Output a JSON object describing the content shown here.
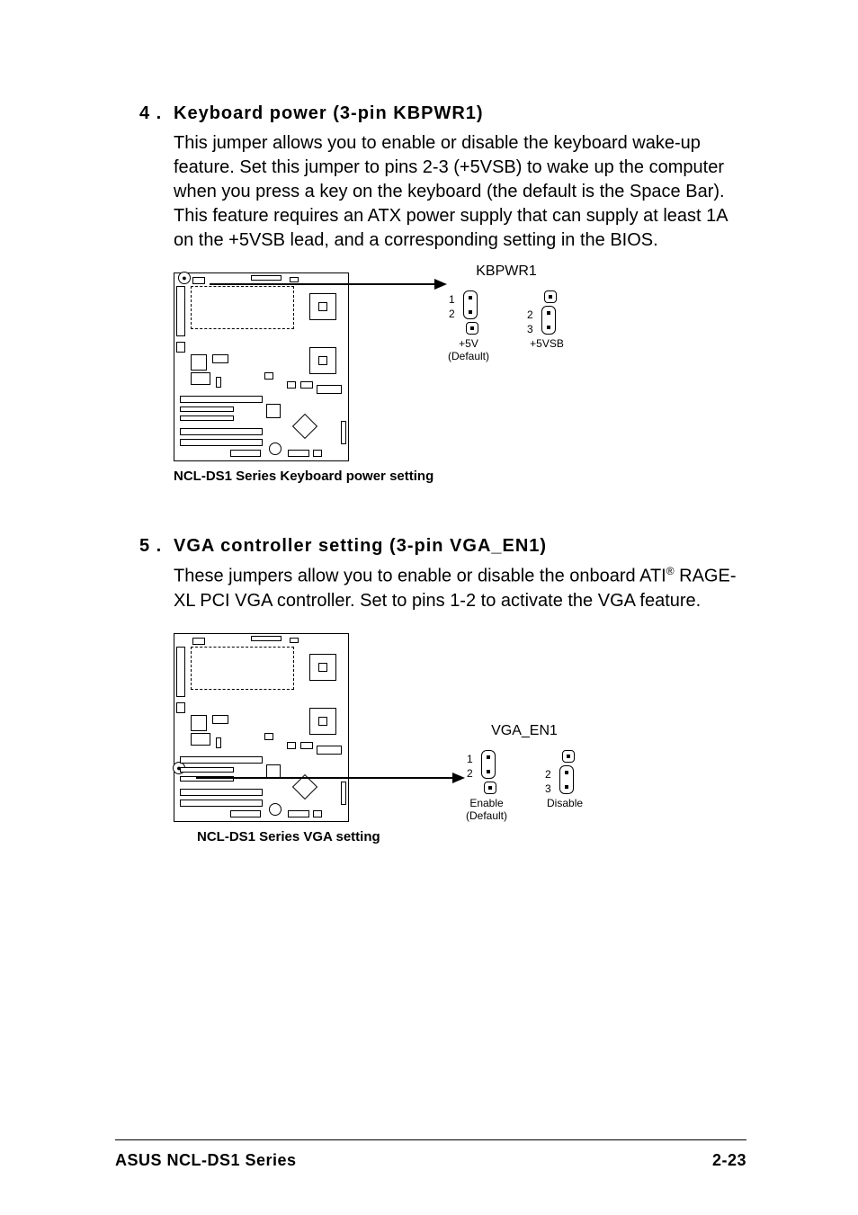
{
  "section4": {
    "num": "4 .",
    "title": "Keyboard power (3-pin KBPWR1)",
    "body": "This jumper allows you to enable or disable the keyboard wake-up feature. Set this jumper to pins 2-3 (+5VSB) to wake up the computer when you press a key on the keyboard (the default is the Space Bar). This feature requires an ATX power supply that can supply at least 1A on the +5VSB lead, and a corresponding setting in the BIOS.",
    "caption": "NCL-DS1 Series Keyboard power setting",
    "jumper_title": "KBPWR1",
    "opt1_pins": [
      "1",
      "2"
    ],
    "opt1_label_a": "+5V",
    "opt1_label_b": "(Default)",
    "opt2_pins": [
      "2",
      "3"
    ],
    "opt2_label_a": "+5VSB",
    "opt2_label_b": ""
  },
  "section5": {
    "num": "5 .",
    "title": "VGA controller setting (3-pin VGA_EN1)",
    "body_a": "These jumpers allow you to enable or disable the onboard ATI",
    "body_b": " RAGE-XL PCI VGA controller. Set to pins 1-2 to activate the VGA feature.",
    "caption": "NCL-DS1 Series VGA setting",
    "jumper_title": "VGA_EN1",
    "opt1_pins": [
      "1",
      "2"
    ],
    "opt1_label_a": "Enable",
    "opt1_label_b": "(Default)",
    "opt2_pins": [
      "2",
      "3"
    ],
    "opt2_label_a": "Disable",
    "opt2_label_b": ""
  },
  "footer": {
    "left": "ASUS NCL-DS1 Series",
    "right": "2-23"
  }
}
